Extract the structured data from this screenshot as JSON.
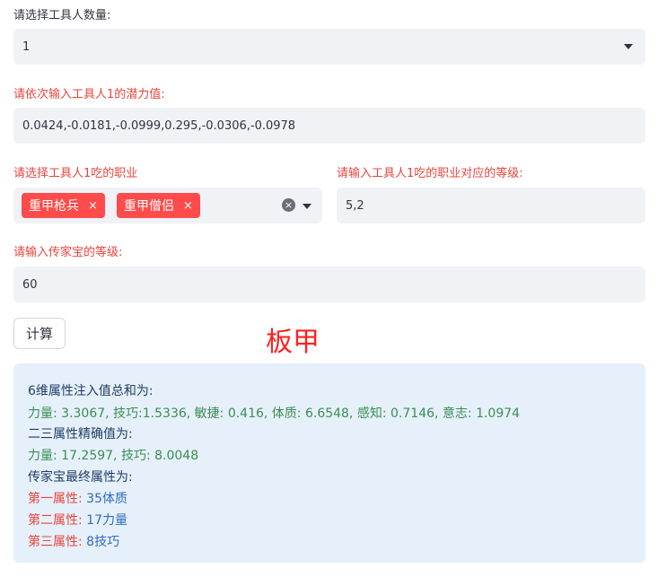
{
  "q1": {
    "label": "请选择工具人数量:",
    "value": "1"
  },
  "q2": {
    "label": "请依次输入工具人1的潜力值:",
    "value": "0.0424,-0.0181,-0.0999,0.295,-0.0306,-0.0978"
  },
  "q3": {
    "label": "请选择工具人1吃的职业",
    "tags": [
      {
        "text": "重甲枪兵"
      },
      {
        "text": "重甲僧侣"
      }
    ],
    "tag_remove_glyph": "×",
    "clear_glyph": "×"
  },
  "q4": {
    "label": "请输入工具人1吃的职业对应的等级:",
    "value": "5,2"
  },
  "q5": {
    "label": "请输入传家宝的等级:",
    "value": "60"
  },
  "compute_button": "计算",
  "big_text": "板甲",
  "result": {
    "line1": "6维属性注入值总和为:",
    "line2": "力量: 3.3067, 技巧:1.5336, 敏捷: 0.416, 体质: 6.6548, 感知: 0.7146, 意志: 1.0974",
    "line3": "二三属性精确值为:",
    "line4": "力量: 17.2597, 技巧: 8.0048",
    "line5": "传家宝最终属性为:",
    "attrs": [
      {
        "label": "第一属性:",
        "value": "35体质"
      },
      {
        "label": "第二属性:",
        "value": "17力量"
      },
      {
        "label": "第三属性:",
        "value": "8技巧"
      }
    ]
  }
}
